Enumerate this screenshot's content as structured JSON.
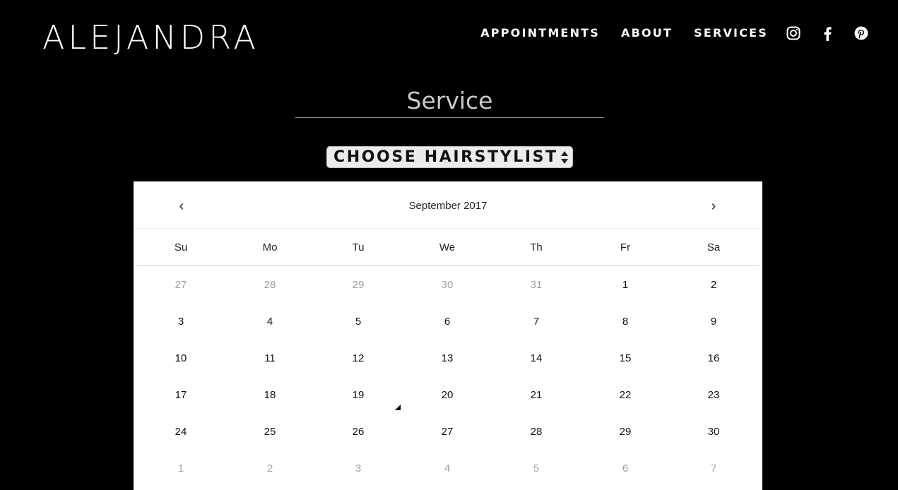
{
  "header": {
    "logo": "ALEJANDRA",
    "nav": [
      "APPOINTMENTS",
      "ABOUT",
      "SERVICES"
    ]
  },
  "social": [
    "instagram-icon",
    "facebook-icon",
    "pinterest-icon"
  ],
  "form": {
    "service_label": "Service",
    "stylist_select": "CHOOSE HAIRSTYLIST"
  },
  "calendar": {
    "month_label": "September 2017",
    "prev": "‹",
    "next": "›",
    "weekdays": [
      "Su",
      "Mo",
      "Tu",
      "We",
      "Th",
      "Fr",
      "Sa"
    ],
    "weeks": [
      [
        {
          "d": "27",
          "m": true
        },
        {
          "d": "28",
          "m": true
        },
        {
          "d": "29",
          "m": true
        },
        {
          "d": "30",
          "m": true
        },
        {
          "d": "31",
          "m": true
        },
        {
          "d": "1",
          "m": false
        },
        {
          "d": "2",
          "m": false
        }
      ],
      [
        {
          "d": "3",
          "m": false
        },
        {
          "d": "4",
          "m": false
        },
        {
          "d": "5",
          "m": false
        },
        {
          "d": "6",
          "m": false
        },
        {
          "d": "7",
          "m": false
        },
        {
          "d": "8",
          "m": false
        },
        {
          "d": "9",
          "m": false
        }
      ],
      [
        {
          "d": "10",
          "m": false
        },
        {
          "d": "11",
          "m": false
        },
        {
          "d": "12",
          "m": false
        },
        {
          "d": "13",
          "m": false
        },
        {
          "d": "14",
          "m": false
        },
        {
          "d": "15",
          "m": false
        },
        {
          "d": "16",
          "m": false
        }
      ],
      [
        {
          "d": "17",
          "m": false
        },
        {
          "d": "18",
          "m": false
        },
        {
          "d": "19",
          "m": false
        },
        {
          "d": "20",
          "m": false
        },
        {
          "d": "21",
          "m": false
        },
        {
          "d": "22",
          "m": false
        },
        {
          "d": "23",
          "m": false
        }
      ],
      [
        {
          "d": "24",
          "m": false
        },
        {
          "d": "25",
          "m": false
        },
        {
          "d": "26",
          "m": false
        },
        {
          "d": "27",
          "m": false
        },
        {
          "d": "28",
          "m": false
        },
        {
          "d": "29",
          "m": false
        },
        {
          "d": "30",
          "m": false
        }
      ],
      [
        {
          "d": "1",
          "m": true
        },
        {
          "d": "2",
          "m": true
        },
        {
          "d": "3",
          "m": true
        },
        {
          "d": "4",
          "m": true
        },
        {
          "d": "5",
          "m": true
        },
        {
          "d": "6",
          "m": true
        },
        {
          "d": "7",
          "m": true
        }
      ]
    ]
  }
}
